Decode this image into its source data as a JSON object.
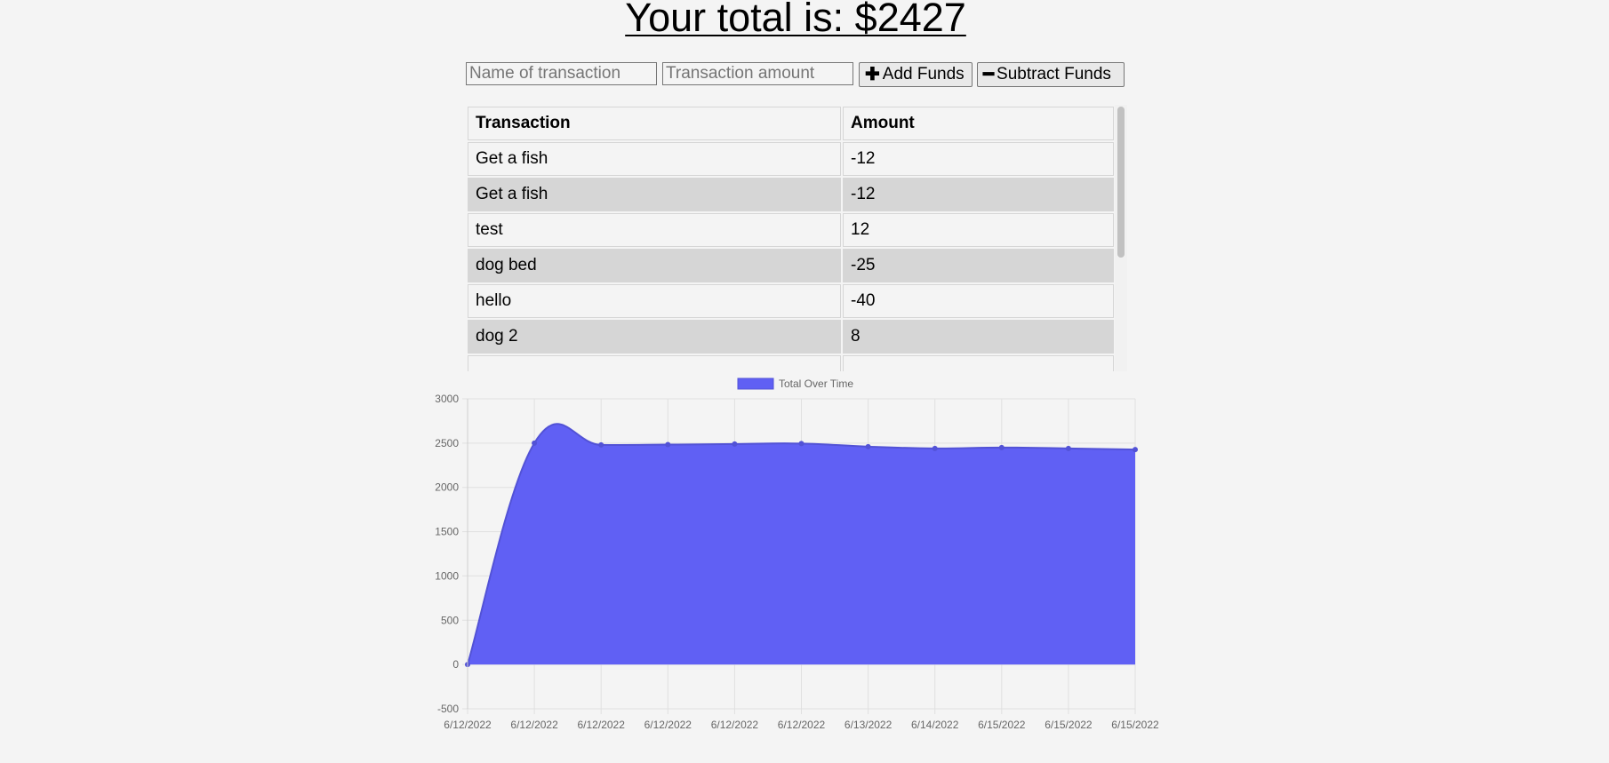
{
  "header": {
    "total_text": "Your total is: $2427"
  },
  "form": {
    "name_placeholder": "Name of transaction",
    "amount_placeholder": "Transaction amount",
    "add_label": "Add Funds",
    "subtract_label": "Subtract Funds"
  },
  "table": {
    "headers": [
      "Transaction",
      "Amount"
    ],
    "rows": [
      {
        "name": "Get a fish",
        "amount": "-12"
      },
      {
        "name": "Get a fish",
        "amount": "-12"
      },
      {
        "name": "test",
        "amount": "12"
      },
      {
        "name": "dog bed",
        "amount": "-25"
      },
      {
        "name": "hello",
        "amount": "-40"
      },
      {
        "name": "dog 2",
        "amount": "8"
      }
    ]
  },
  "colors": {
    "series_fill": "#6060f4",
    "series_line": "#5252d6"
  },
  "chart_data": {
    "type": "area",
    "legend_position": "top",
    "grid": true,
    "categories": [
      "6/12/2022",
      "6/12/2022",
      "6/12/2022",
      "6/12/2022",
      "6/12/2022",
      "6/12/2022",
      "6/13/2022",
      "6/14/2022",
      "6/15/2022",
      "6/15/2022",
      "6/15/2022"
    ],
    "series": [
      {
        "name": "Total Over Time",
        "values": [
          0,
          2500,
          2480,
          2483,
          2490,
          2495,
          2460,
          2440,
          2450,
          2440,
          2427
        ]
      }
    ],
    "ylim": [
      -500,
      3000
    ],
    "yticks": [
      3000,
      2500,
      2000,
      1500,
      1000,
      500,
      0,
      -500
    ]
  }
}
